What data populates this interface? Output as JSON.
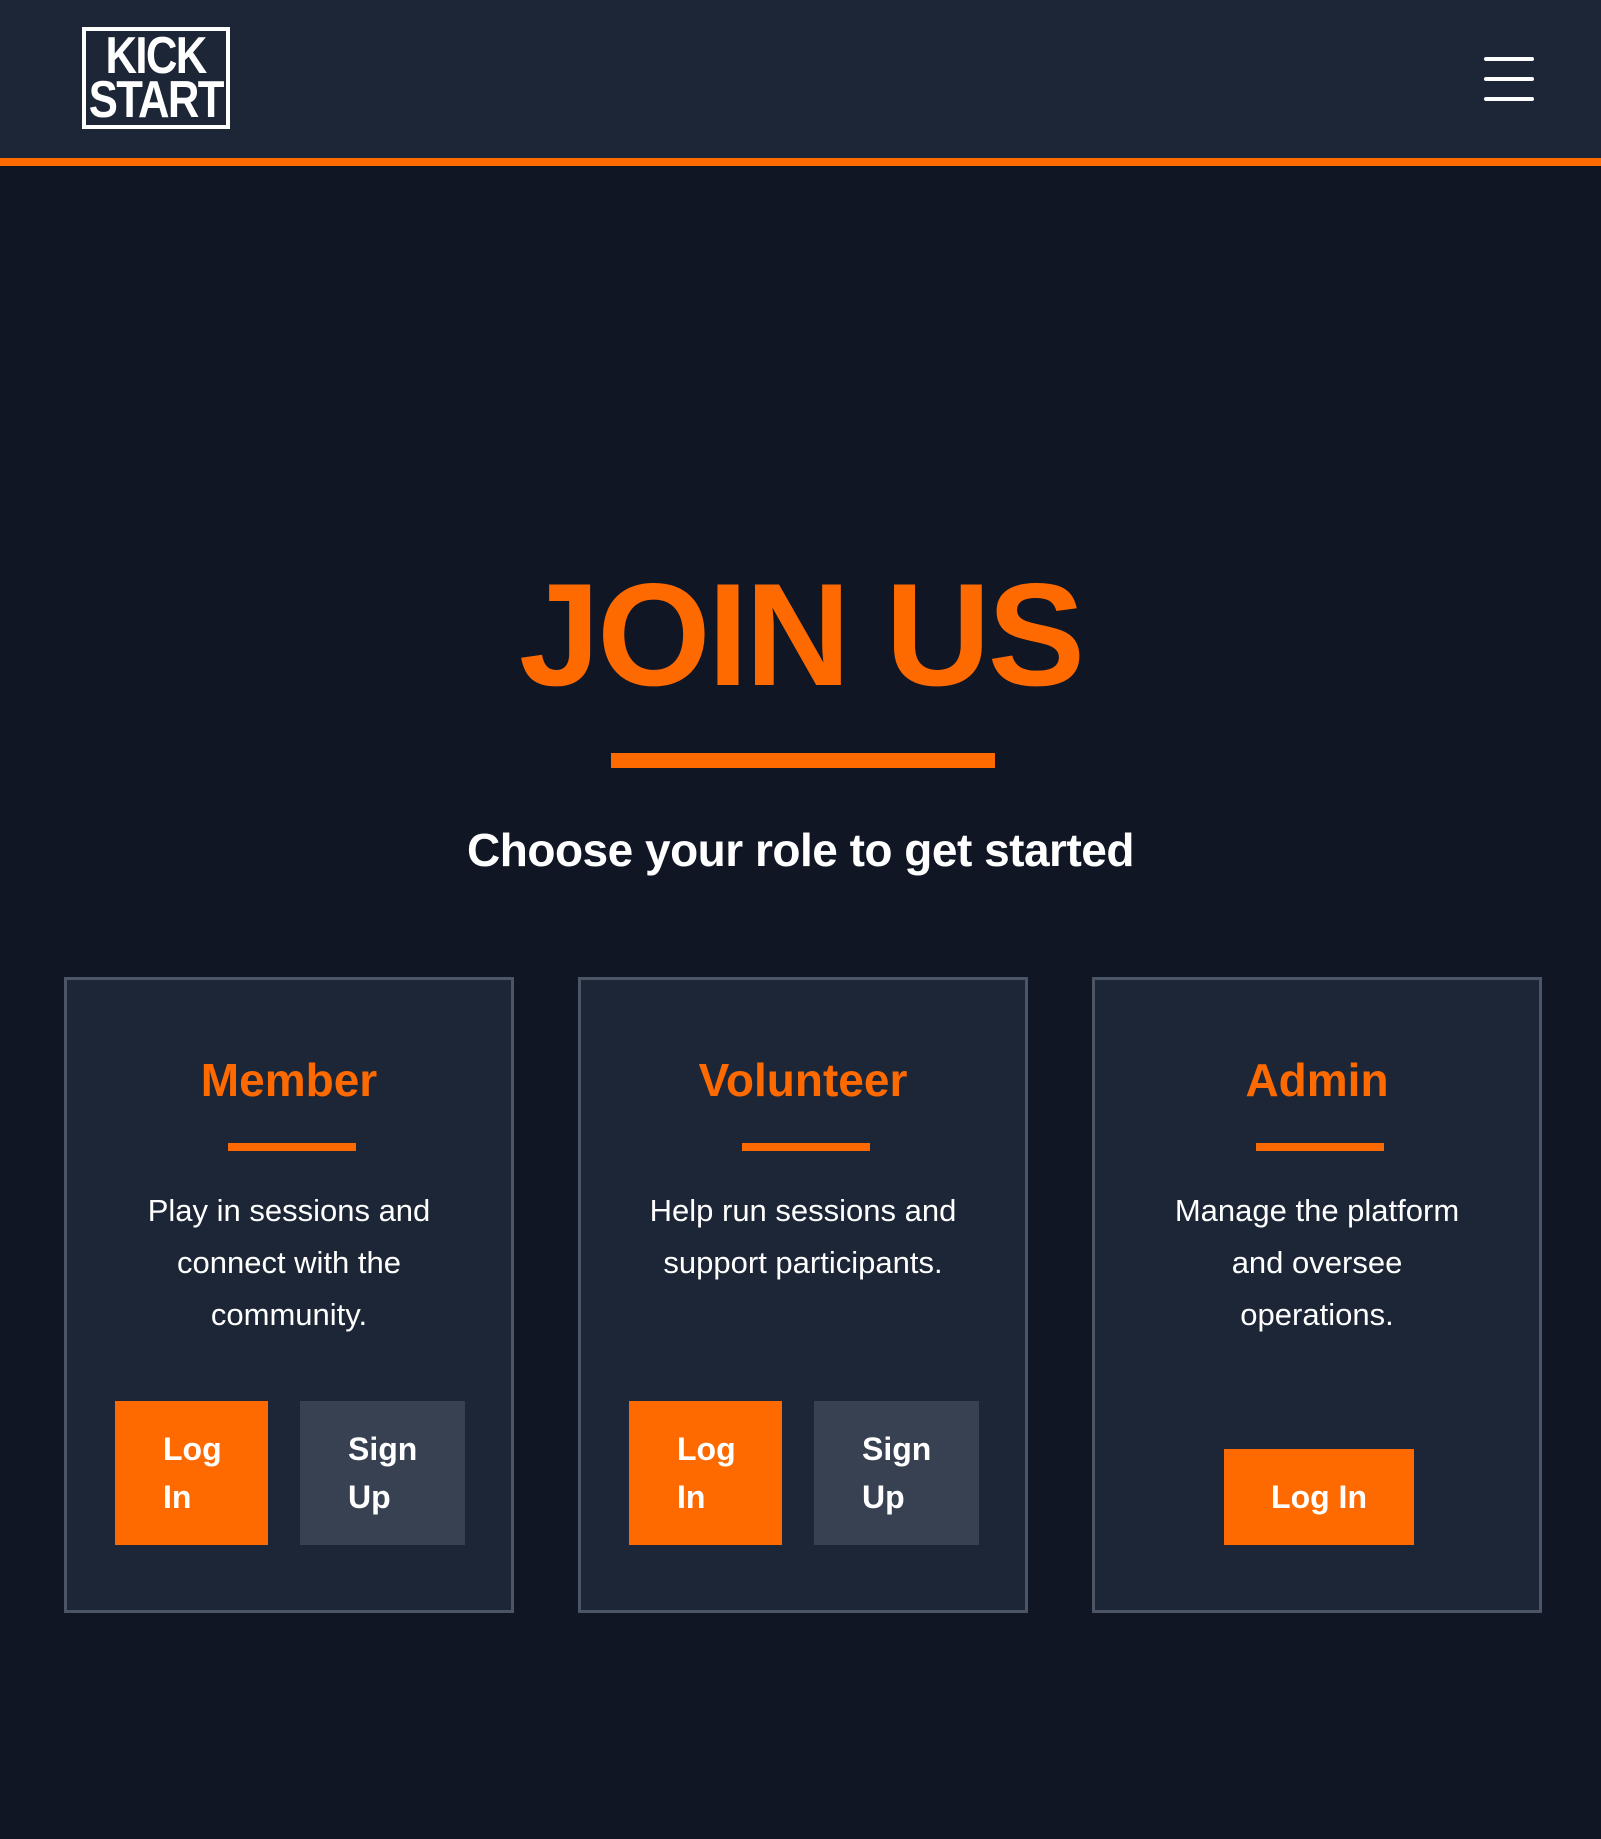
{
  "header": {
    "logo_line1": "KICK",
    "logo_line2": "START",
    "menu_icon": "hamburger-menu-icon"
  },
  "hero": {
    "title": "JOIN US",
    "subtitle": "Choose your role to get started"
  },
  "colors": {
    "accent": "#ff6a00",
    "background": "#111625",
    "card": "#1d2636",
    "card_border": "#4b5566",
    "secondary_button": "#374152"
  },
  "cards": [
    {
      "title": "Member",
      "description": "Play in sessions and connect with the community.",
      "login_label": "Log In",
      "signup_label": "Sign Up"
    },
    {
      "title": "Volunteer",
      "description": "Help run sessions and support participants.",
      "login_label": "Log In",
      "signup_label": "Sign Up"
    },
    {
      "title": "Admin",
      "description": "Manage the platform and oversee operations.",
      "login_label": "Log In"
    }
  ]
}
